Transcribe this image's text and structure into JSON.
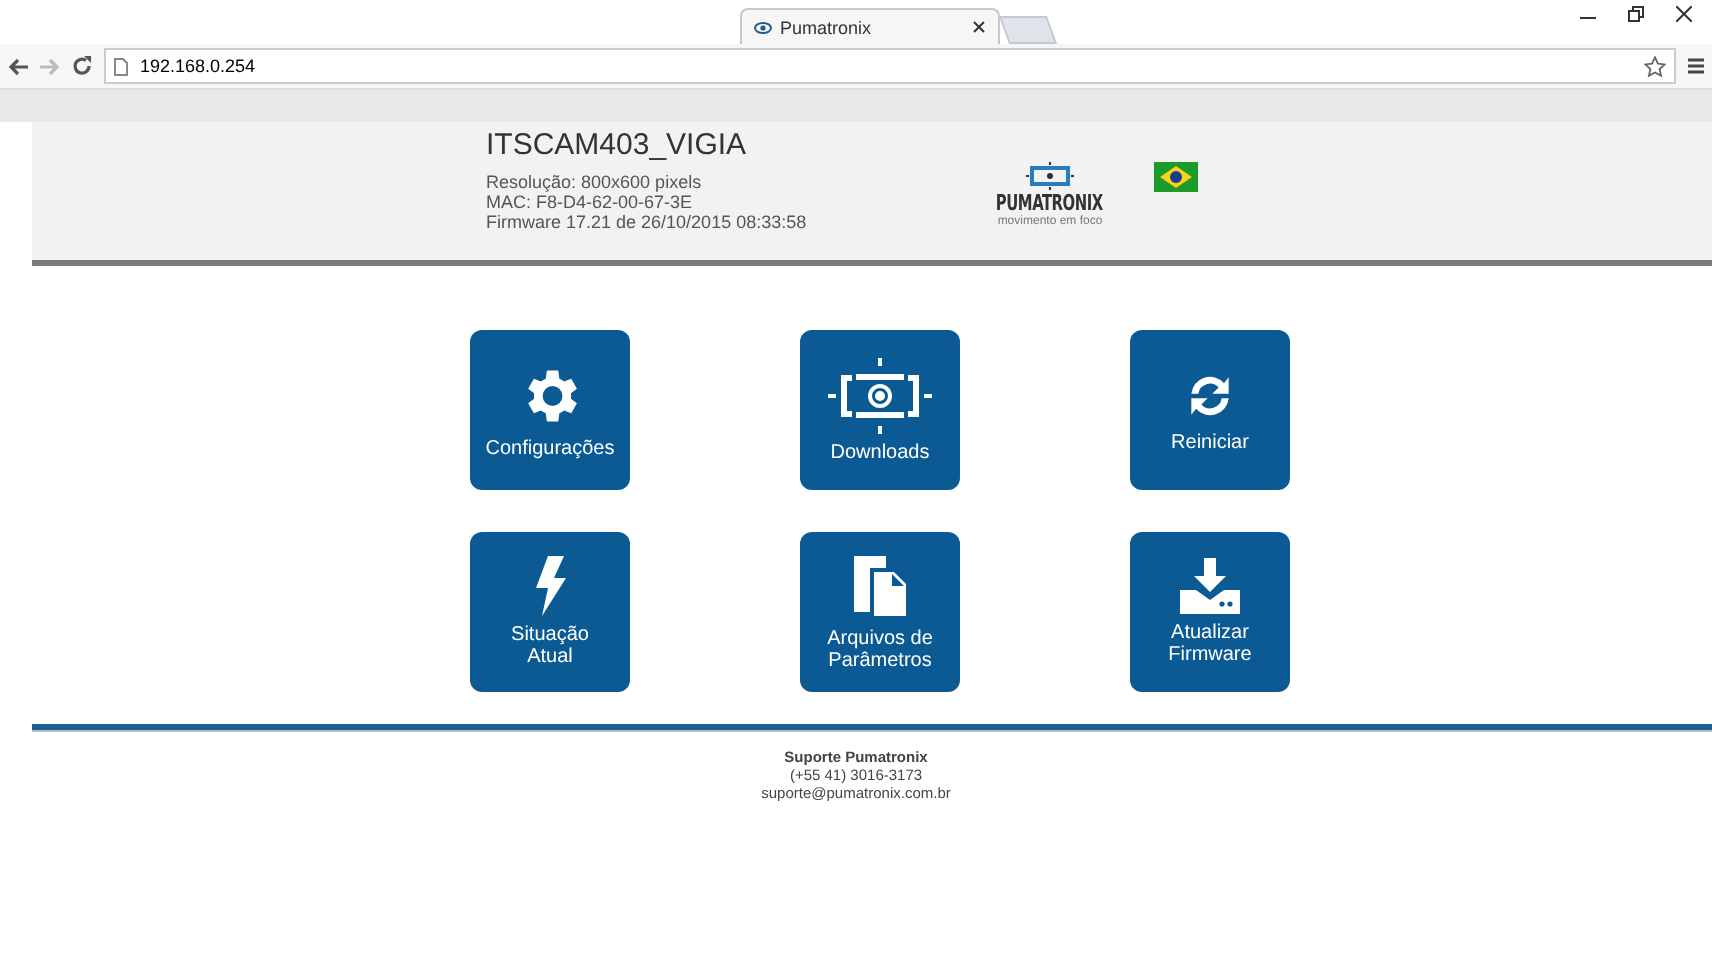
{
  "browser": {
    "tab_title": "Pumatronix",
    "url": "192.168.0.254"
  },
  "header": {
    "title": "ITSCAM403_VIGIA",
    "details": [
      "Resolução: 800x600 pixels",
      "MAC: F8-D4-62-00-67-3E",
      "Firmware 17.21 de 26/10/2015 08:33:58"
    ],
    "logo_text": "PUMATRONIX",
    "logo_tagline": "movimento em foco"
  },
  "tiles": [
    {
      "label_lines": [
        "Configurações"
      ],
      "kind": "gear"
    },
    {
      "label_lines": [
        "Downloads"
      ],
      "kind": "camera"
    },
    {
      "label_lines": [
        "Reiniciar"
      ],
      "kind": "refresh"
    },
    {
      "label_lines": [
        "Situação",
        "Atual"
      ],
      "kind": "bolt"
    },
    {
      "label_lines": [
        "Arquivos de",
        "Parâmetros"
      ],
      "kind": "files"
    },
    {
      "label_lines": [
        "Atualizar",
        "Firmware"
      ],
      "kind": "download"
    }
  ],
  "footer": {
    "title": "Suporte Pumatronix",
    "phone": "(+55 41) 3016-3173",
    "email": "suporte@pumatronix.com.br"
  }
}
